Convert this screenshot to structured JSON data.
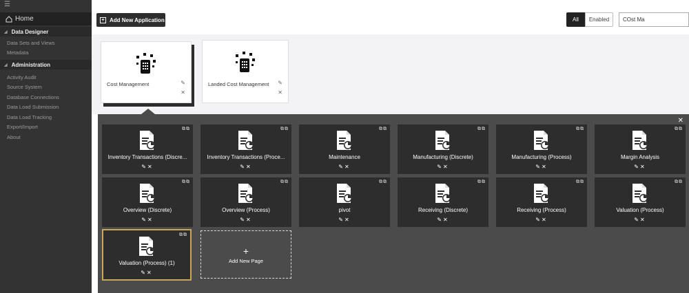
{
  "sidebar": {
    "hamburger": "☰",
    "home": "Home",
    "sections": [
      {
        "label": "Data Designer",
        "items": [
          "Data Sets and Views",
          "Metadata"
        ]
      },
      {
        "label": "Administration",
        "items": [
          "Activity Audit",
          "Source System",
          "Database Connections",
          "Data Load Submission",
          "Data Load Tracking",
          "Export/Import",
          "About"
        ]
      }
    ]
  },
  "toolbar": {
    "add_application_label": "Add New Application",
    "filter_all": "All",
    "filter_enabled": "Enabled",
    "search_value": "COst Ma"
  },
  "applications": [
    {
      "name": "Cost Management",
      "selected": true
    },
    {
      "name": "Landed Cost Management",
      "selected": false
    }
  ],
  "pages_panel": {
    "close_glyph": "✕",
    "pages": [
      {
        "title": "Inventory Transactions (Discre..."
      },
      {
        "title": "Inventory Transactions (Proce..."
      },
      {
        "title": "Maintenance"
      },
      {
        "title": "Manufacturing (Discrete)"
      },
      {
        "title": "Manufacturing (Process)"
      },
      {
        "title": "Margin Analysis"
      },
      {
        "title": "Overview (Discrete)"
      },
      {
        "title": "Overview (Process)"
      },
      {
        "title": "pivot"
      },
      {
        "title": "Receiving (Discrete)"
      },
      {
        "title": "Receiving (Process)"
      },
      {
        "title": "Valuation (Process)"
      },
      {
        "title": "Valuation (Process) (1)",
        "selected": true
      }
    ],
    "add_page_label": "Add New Page",
    "add_page_glyph": "+"
  },
  "colors": {
    "sidebar_bg": "#333333",
    "panel_bg": "#4b4b4b",
    "card_bg": "#2d2d2d",
    "selected_border": "#c9a85a"
  }
}
